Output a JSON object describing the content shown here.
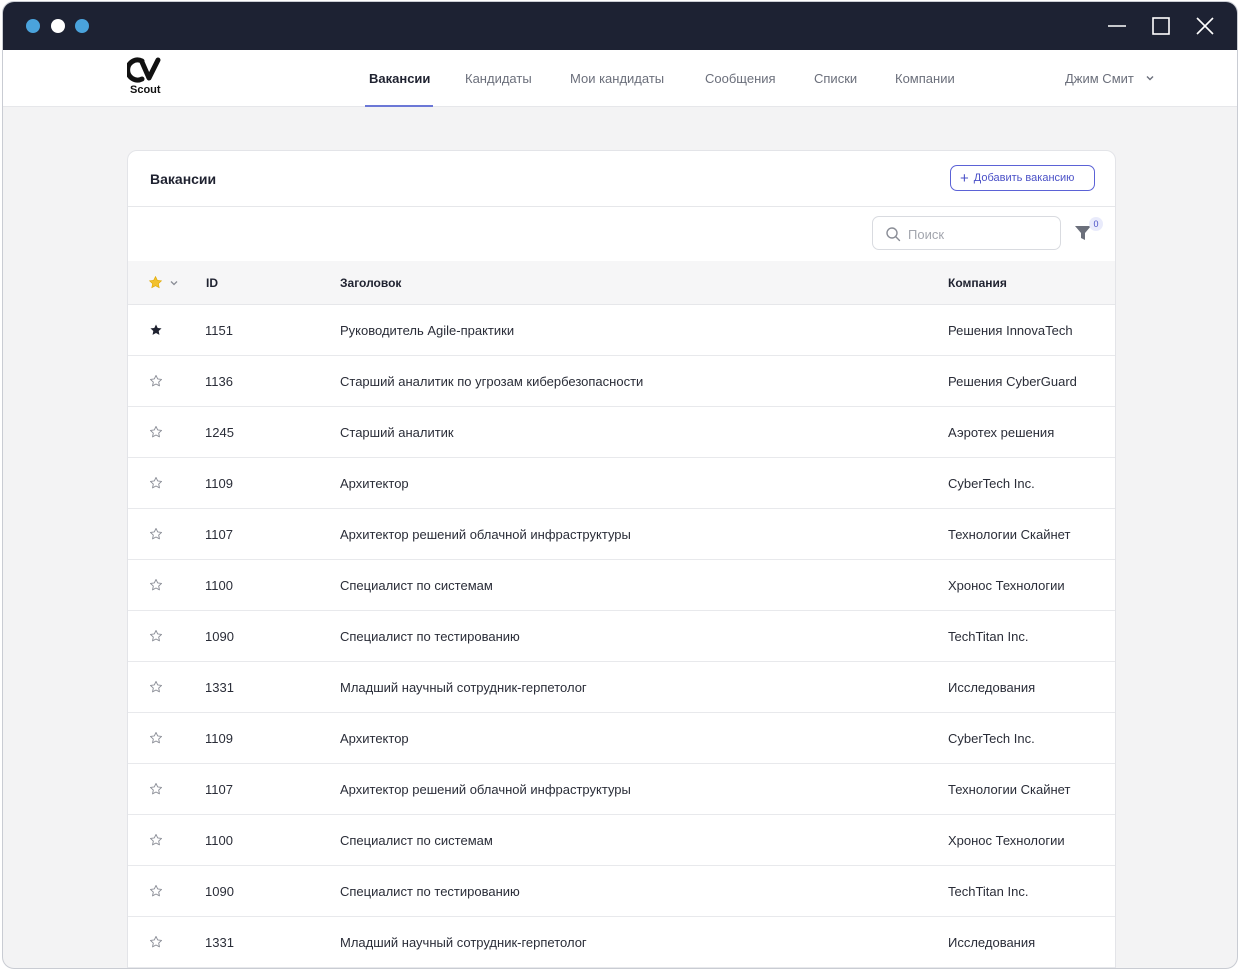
{
  "app": {
    "logo_text": "Scout"
  },
  "nav": {
    "items": [
      {
        "label": "Вакансии",
        "active": true
      },
      {
        "label": "Кандидаты",
        "active": false
      },
      {
        "label": "Мои кандидаты",
        "active": false
      },
      {
        "label": "Сообщения",
        "active": false
      },
      {
        "label": "Списки",
        "active": false
      },
      {
        "label": "Компании",
        "active": false
      }
    ],
    "user_name": "Джим Смит"
  },
  "card": {
    "title": "Вакансии",
    "add_button_label": "Добавить вакансию",
    "search_placeholder": "Поиск",
    "filter_count": "0"
  },
  "table": {
    "columns": {
      "id": "ID",
      "title": "Заголовок",
      "company": "Компания"
    },
    "rows": [
      {
        "favorite": true,
        "id": "1151",
        "title": "Руководитель Agile-практики",
        "company": "Решения InnovaTech"
      },
      {
        "favorite": false,
        "id": "1136",
        "title": "Старший аналитик по угрозам кибербезопасности",
        "company": "Решения CyberGuard"
      },
      {
        "favorite": false,
        "id": "1245",
        "title": "Старший аналитик",
        "company": "Аэротех решения"
      },
      {
        "favorite": false,
        "id": "1109",
        "title": "Архитектор",
        "company": "CyberTech Inc."
      },
      {
        "favorite": false,
        "id": "1107",
        "title": "Архитектор решений облачной инфраструктуры",
        "company": "Технологии Скайнет"
      },
      {
        "favorite": false,
        "id": "1100",
        "title": "Специалист по  системам",
        "company": "Хронос Технологии"
      },
      {
        "favorite": false,
        "id": "1090",
        "title": "Специалист по тестированию",
        "company": "TechTitan Inc."
      },
      {
        "favorite": false,
        "id": "1331",
        "title": "Младший научный сотрудник-герпетолог",
        "company": "Исследования"
      },
      {
        "favorite": false,
        "id": "1109",
        "title": "Архитектор",
        "company": "CyberTech Inc."
      },
      {
        "favorite": false,
        "id": "1107",
        "title": "Архитектор решений облачной инфраструктуры",
        "company": "Технологии Скайнет"
      },
      {
        "favorite": false,
        "id": "1100",
        "title": "Специалист по  системам",
        "company": "Хронос Технологии"
      },
      {
        "favorite": false,
        "id": "1090",
        "title": "Специалист по тестированию",
        "company": "TechTitan Inc."
      },
      {
        "favorite": false,
        "id": "1331",
        "title": "Младший научный сотрудник-герпетолог",
        "company": "Исследования"
      }
    ]
  },
  "colors": {
    "titlebar": "#1d2233",
    "accent": "#5b62d6",
    "dot_blue": "#4aa3dc",
    "star_header": "#f2c12e"
  },
  "icons": [
    "window-dot-icon",
    "minimize-icon",
    "maximize-icon",
    "close-icon",
    "cv-logo-icon",
    "chevron-down-icon",
    "plus-icon",
    "search-icon",
    "filter-icon",
    "star-icon",
    "star-outline-icon"
  ]
}
